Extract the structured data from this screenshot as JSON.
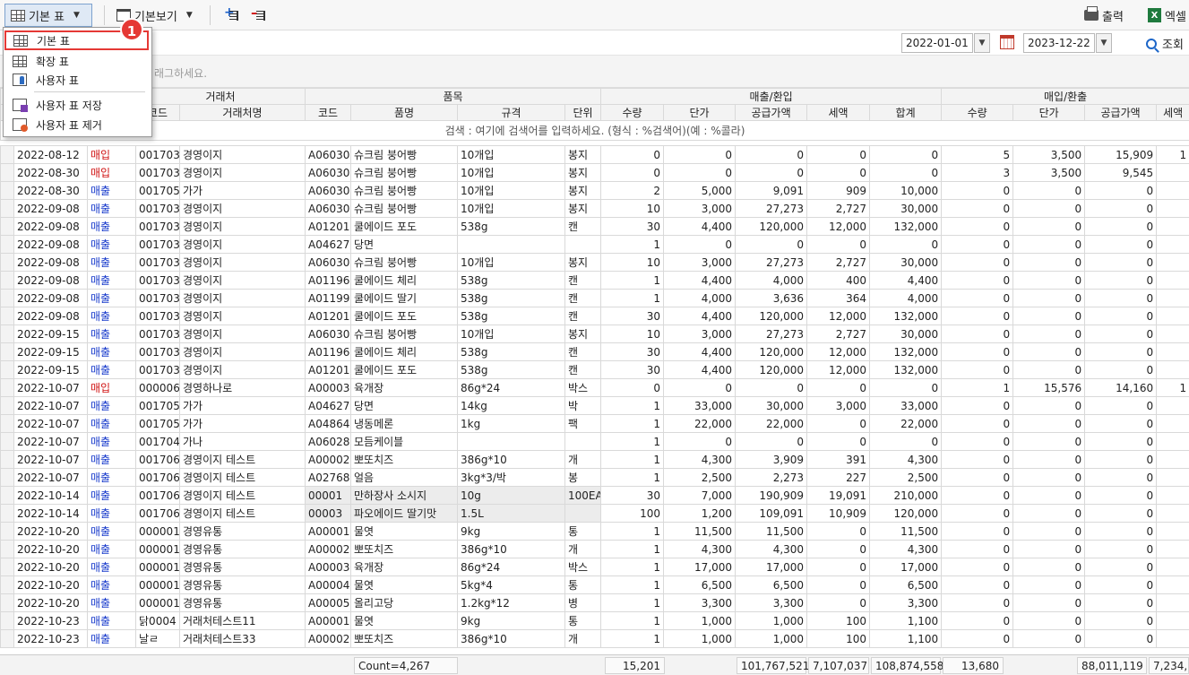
{
  "toolbar": {
    "table_select_label": "기본 표",
    "view_label": "기본보기",
    "print_label": "출력",
    "excel_label": "엑셀"
  },
  "filters": {
    "start_date": "2022-01-01",
    "end_date": "2023-12-22",
    "search_label": "조회"
  },
  "group_hint": "래그하세요.",
  "menu": {
    "items": [
      "기본 표",
      "확장 표",
      "사용자 표",
      "사용자 표 저장",
      "사용자 표 제거"
    ],
    "badge": "1"
  },
  "grid": {
    "group_headers": [
      "거래처",
      "품목",
      "매출/환입",
      "매입/환출"
    ],
    "columns": [
      "코드",
      "거래처명",
      "코드",
      "품명",
      "규격",
      "단위",
      "수량",
      "단가",
      "공급가액",
      "세액",
      "합계",
      "수량",
      "단가",
      "공급가액",
      "세액"
    ],
    "search_hint": "검색 : 여기에 검색어를 입력하세요. (형식 : %검색어)(예 : %콜라)",
    "rows": [
      [
        "2022-08-12",
        "매입",
        "001703",
        "경영이지",
        "A06030",
        "슈크림 붕어빵",
        "10개입",
        "봉지",
        "0",
        "0",
        "0",
        "0",
        "0",
        "5",
        "3,500",
        "15,909",
        "1"
      ],
      [
        "2022-08-30",
        "매입",
        "001703",
        "경영이지",
        "A06030",
        "슈크림 붕어빵",
        "10개입",
        "봉지",
        "0",
        "0",
        "0",
        "0",
        "0",
        "3",
        "3,500",
        "9,545",
        ""
      ],
      [
        "2022-08-30",
        "매출",
        "001705",
        "가가",
        "A06030",
        "슈크림 붕어빵",
        "10개입",
        "봉지",
        "2",
        "5,000",
        "9,091",
        "909",
        "10,000",
        "0",
        "0",
        "0",
        ""
      ],
      [
        "2022-09-08",
        "매출",
        "001703",
        "경영이지",
        "A06030",
        "슈크림 붕어빵",
        "10개입",
        "봉지",
        "10",
        "3,000",
        "27,273",
        "2,727",
        "30,000",
        "0",
        "0",
        "0",
        ""
      ],
      [
        "2022-09-08",
        "매출",
        "001703",
        "경영이지",
        "A01201",
        "쿨에이드 포도",
        "538g",
        "캔",
        "30",
        "4,400",
        "120,000",
        "12,000",
        "132,000",
        "0",
        "0",
        "0",
        ""
      ],
      [
        "2022-09-08",
        "매출",
        "001703",
        "경영이지",
        "A04627",
        "당면",
        "",
        "",
        "1",
        "0",
        "0",
        "0",
        "0",
        "0",
        "0",
        "0",
        ""
      ],
      [
        "2022-09-08",
        "매출",
        "001703",
        "경영이지",
        "A06030",
        "슈크림 붕어빵",
        "10개입",
        "봉지",
        "10",
        "3,000",
        "27,273",
        "2,727",
        "30,000",
        "0",
        "0",
        "0",
        ""
      ],
      [
        "2022-09-08",
        "매출",
        "001703",
        "경영이지",
        "A01196",
        "쿨에이드 체리",
        "538g",
        "캔",
        "1",
        "4,400",
        "4,000",
        "400",
        "4,400",
        "0",
        "0",
        "0",
        ""
      ],
      [
        "2022-09-08",
        "매출",
        "001703",
        "경영이지",
        "A01199",
        "쿨에이드 딸기",
        "538g",
        "캔",
        "1",
        "4,000",
        "3,636",
        "364",
        "4,000",
        "0",
        "0",
        "0",
        ""
      ],
      [
        "2022-09-08",
        "매출",
        "001703",
        "경영이지",
        "A01201",
        "쿨에이드 포도",
        "538g",
        "캔",
        "30",
        "4,400",
        "120,000",
        "12,000",
        "132,000",
        "0",
        "0",
        "0",
        ""
      ],
      [
        "2022-09-15",
        "매출",
        "001703",
        "경영이지",
        "A06030",
        "슈크림 붕어빵",
        "10개입",
        "봉지",
        "10",
        "3,000",
        "27,273",
        "2,727",
        "30,000",
        "0",
        "0",
        "0",
        ""
      ],
      [
        "2022-09-15",
        "매출",
        "001703",
        "경영이지",
        "A01196",
        "쿨에이드 체리",
        "538g",
        "캔",
        "30",
        "4,400",
        "120,000",
        "12,000",
        "132,000",
        "0",
        "0",
        "0",
        ""
      ],
      [
        "2022-09-15",
        "매출",
        "001703",
        "경영이지",
        "A01201",
        "쿨에이드 포도",
        "538g",
        "캔",
        "30",
        "4,400",
        "120,000",
        "12,000",
        "132,000",
        "0",
        "0",
        "0",
        ""
      ],
      [
        "2022-10-07",
        "매입",
        "000006",
        "경영하나로",
        "A00003",
        "육개장",
        "86g*24",
        "박스",
        "0",
        "0",
        "0",
        "0",
        "0",
        "1",
        "15,576",
        "14,160",
        "1"
      ],
      [
        "2022-10-07",
        "매출",
        "001705",
        "가가",
        "A04627",
        "당면",
        "14kg",
        "박",
        "1",
        "33,000",
        "30,000",
        "3,000",
        "33,000",
        "0",
        "0",
        "0",
        ""
      ],
      [
        "2022-10-07",
        "매출",
        "001705",
        "가가",
        "A04864",
        "냉동메론",
        "1kg",
        "팩",
        "1",
        "22,000",
        "22,000",
        "0",
        "22,000",
        "0",
        "0",
        "0",
        ""
      ],
      [
        "2022-10-07",
        "매출",
        "001704",
        "가나",
        "A06028",
        "모듬케이블",
        "",
        "",
        "1",
        "0",
        "0",
        "0",
        "0",
        "0",
        "0",
        "0",
        ""
      ],
      [
        "2022-10-07",
        "매출",
        "001706",
        "경영이지 테스트",
        "A00002",
        "뽀또치즈",
        "386g*10",
        "개",
        "1",
        "4,300",
        "3,909",
        "391",
        "4,300",
        "0",
        "0",
        "0",
        ""
      ],
      [
        "2022-10-07",
        "매출",
        "001706",
        "경영이지 테스트",
        "A02768",
        "얼음",
        "3kg*3/박",
        "봉",
        "1",
        "2,500",
        "2,273",
        "227",
        "2,500",
        "0",
        "0",
        "0",
        ""
      ],
      [
        "2022-10-14",
        "매출",
        "001706",
        "경영이지 테스트",
        "00001",
        "만하장사 소시지",
        "10g",
        "100EA",
        "30",
        "7,000",
        "190,909",
        "19,091",
        "210,000",
        "0",
        "0",
        "0",
        ""
      ],
      [
        "2022-10-14",
        "매출",
        "001706",
        "경영이지 테스트",
        "00003",
        "파오에이드 딸기맛",
        "1.5L",
        "",
        "100",
        "1,200",
        "109,091",
        "10,909",
        "120,000",
        "0",
        "0",
        "0",
        ""
      ],
      [
        "2022-10-20",
        "매출",
        "000001",
        "경영유통",
        "A00001",
        "물엿",
        "9kg",
        "통",
        "1",
        "11,500",
        "11,500",
        "0",
        "11,500",
        "0",
        "0",
        "0",
        ""
      ],
      [
        "2022-10-20",
        "매출",
        "000001",
        "경영유통",
        "A00002",
        "뽀또치즈",
        "386g*10",
        "개",
        "1",
        "4,300",
        "4,300",
        "0",
        "4,300",
        "0",
        "0",
        "0",
        ""
      ],
      [
        "2022-10-20",
        "매출",
        "000001",
        "경영유통",
        "A00003",
        "육개장",
        "86g*24",
        "박스",
        "1",
        "17,000",
        "17,000",
        "0",
        "17,000",
        "0",
        "0",
        "0",
        ""
      ],
      [
        "2022-10-20",
        "매출",
        "000001",
        "경영유통",
        "A00004",
        "물엿",
        "5kg*4",
        "통",
        "1",
        "6,500",
        "6,500",
        "0",
        "6,500",
        "0",
        "0",
        "0",
        ""
      ],
      [
        "2022-10-20",
        "매출",
        "000001",
        "경영유통",
        "A00005",
        "올리고당",
        "1.2kg*12",
        "병",
        "1",
        "3,300",
        "3,300",
        "0",
        "3,300",
        "0",
        "0",
        "0",
        ""
      ],
      [
        "2022-10-23",
        "매출",
        "닭0004",
        "거래처테스트11",
        "A00001",
        "물엿",
        "9kg",
        "통",
        "1",
        "1,000",
        "1,000",
        "100",
        "1,100",
        "0",
        "0",
        "0",
        ""
      ],
      [
        "2022-10-23",
        "매출",
        "날ㄹ",
        "거래처테스트33",
        "A00002",
        "뽀또치즈",
        "386g*10",
        "개",
        "1",
        "1,000",
        "1,000",
        "100",
        "1,100",
        "0",
        "0",
        "0",
        ""
      ]
    ]
  },
  "footer": {
    "count": "Count=4,267",
    "sale_qty": "15,201",
    "sale_supply": "101,767,521",
    "sale_tax": "7,107,037",
    "sale_total": "108,874,558",
    "buy_qty": "13,680",
    "buy_supply": "88,011,119",
    "buy_tax": "7,234,"
  },
  "colors": {
    "sale": "#1a3ccc",
    "buy": "#d01515",
    "highlight": "#e53935"
  }
}
